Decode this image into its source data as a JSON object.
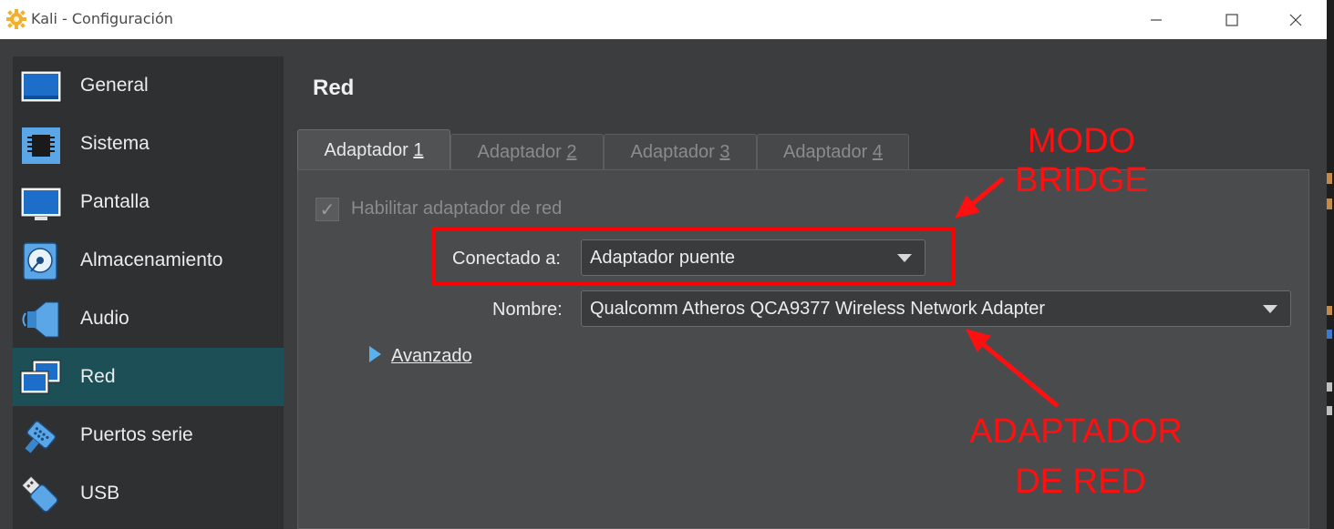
{
  "window": {
    "title": "Kali - Configuración",
    "minimize_icon": "minimize-icon",
    "maximize_icon": "maximize-icon",
    "close_icon": "close-icon"
  },
  "sidebar": {
    "items": [
      {
        "label": "General",
        "icon": "general-monitor-icon",
        "selected": false
      },
      {
        "label": "Sistema",
        "icon": "chip-icon",
        "selected": false
      },
      {
        "label": "Pantalla",
        "icon": "display-icon",
        "selected": false
      },
      {
        "label": "Almacenamiento",
        "icon": "disk-icon",
        "selected": false
      },
      {
        "label": "Audio",
        "icon": "speaker-icon",
        "selected": false
      },
      {
        "label": "Red",
        "icon": "network-icon",
        "selected": true
      },
      {
        "label": "Puertos serie",
        "icon": "serial-port-icon",
        "selected": false
      },
      {
        "label": "USB",
        "icon": "usb-icon",
        "selected": false
      }
    ]
  },
  "page": {
    "title": "Red"
  },
  "tabs": [
    {
      "label": "Adaptador ",
      "num": "1",
      "active": true
    },
    {
      "label": "Adaptador ",
      "num": "2",
      "active": false
    },
    {
      "label": "Adaptador ",
      "num": "3",
      "active": false
    },
    {
      "label": "Adaptador ",
      "num": "4",
      "active": false
    }
  ],
  "form": {
    "enable_label": "Habilitar adaptador de red",
    "enable_checked": true,
    "connected_label": "Conectado a:",
    "connected_value": "Adaptador puente",
    "name_label": "Nombre:",
    "name_value": "Qualcomm Atheros QCA9377 Wireless Network Adapter",
    "advanced_label": "Avanzado"
  },
  "annotations": {
    "top": "MODO BRIDGE",
    "bottom_line1": "ADAPTADOR",
    "bottom_line2": "DE RED",
    "color": "#ff1010"
  }
}
